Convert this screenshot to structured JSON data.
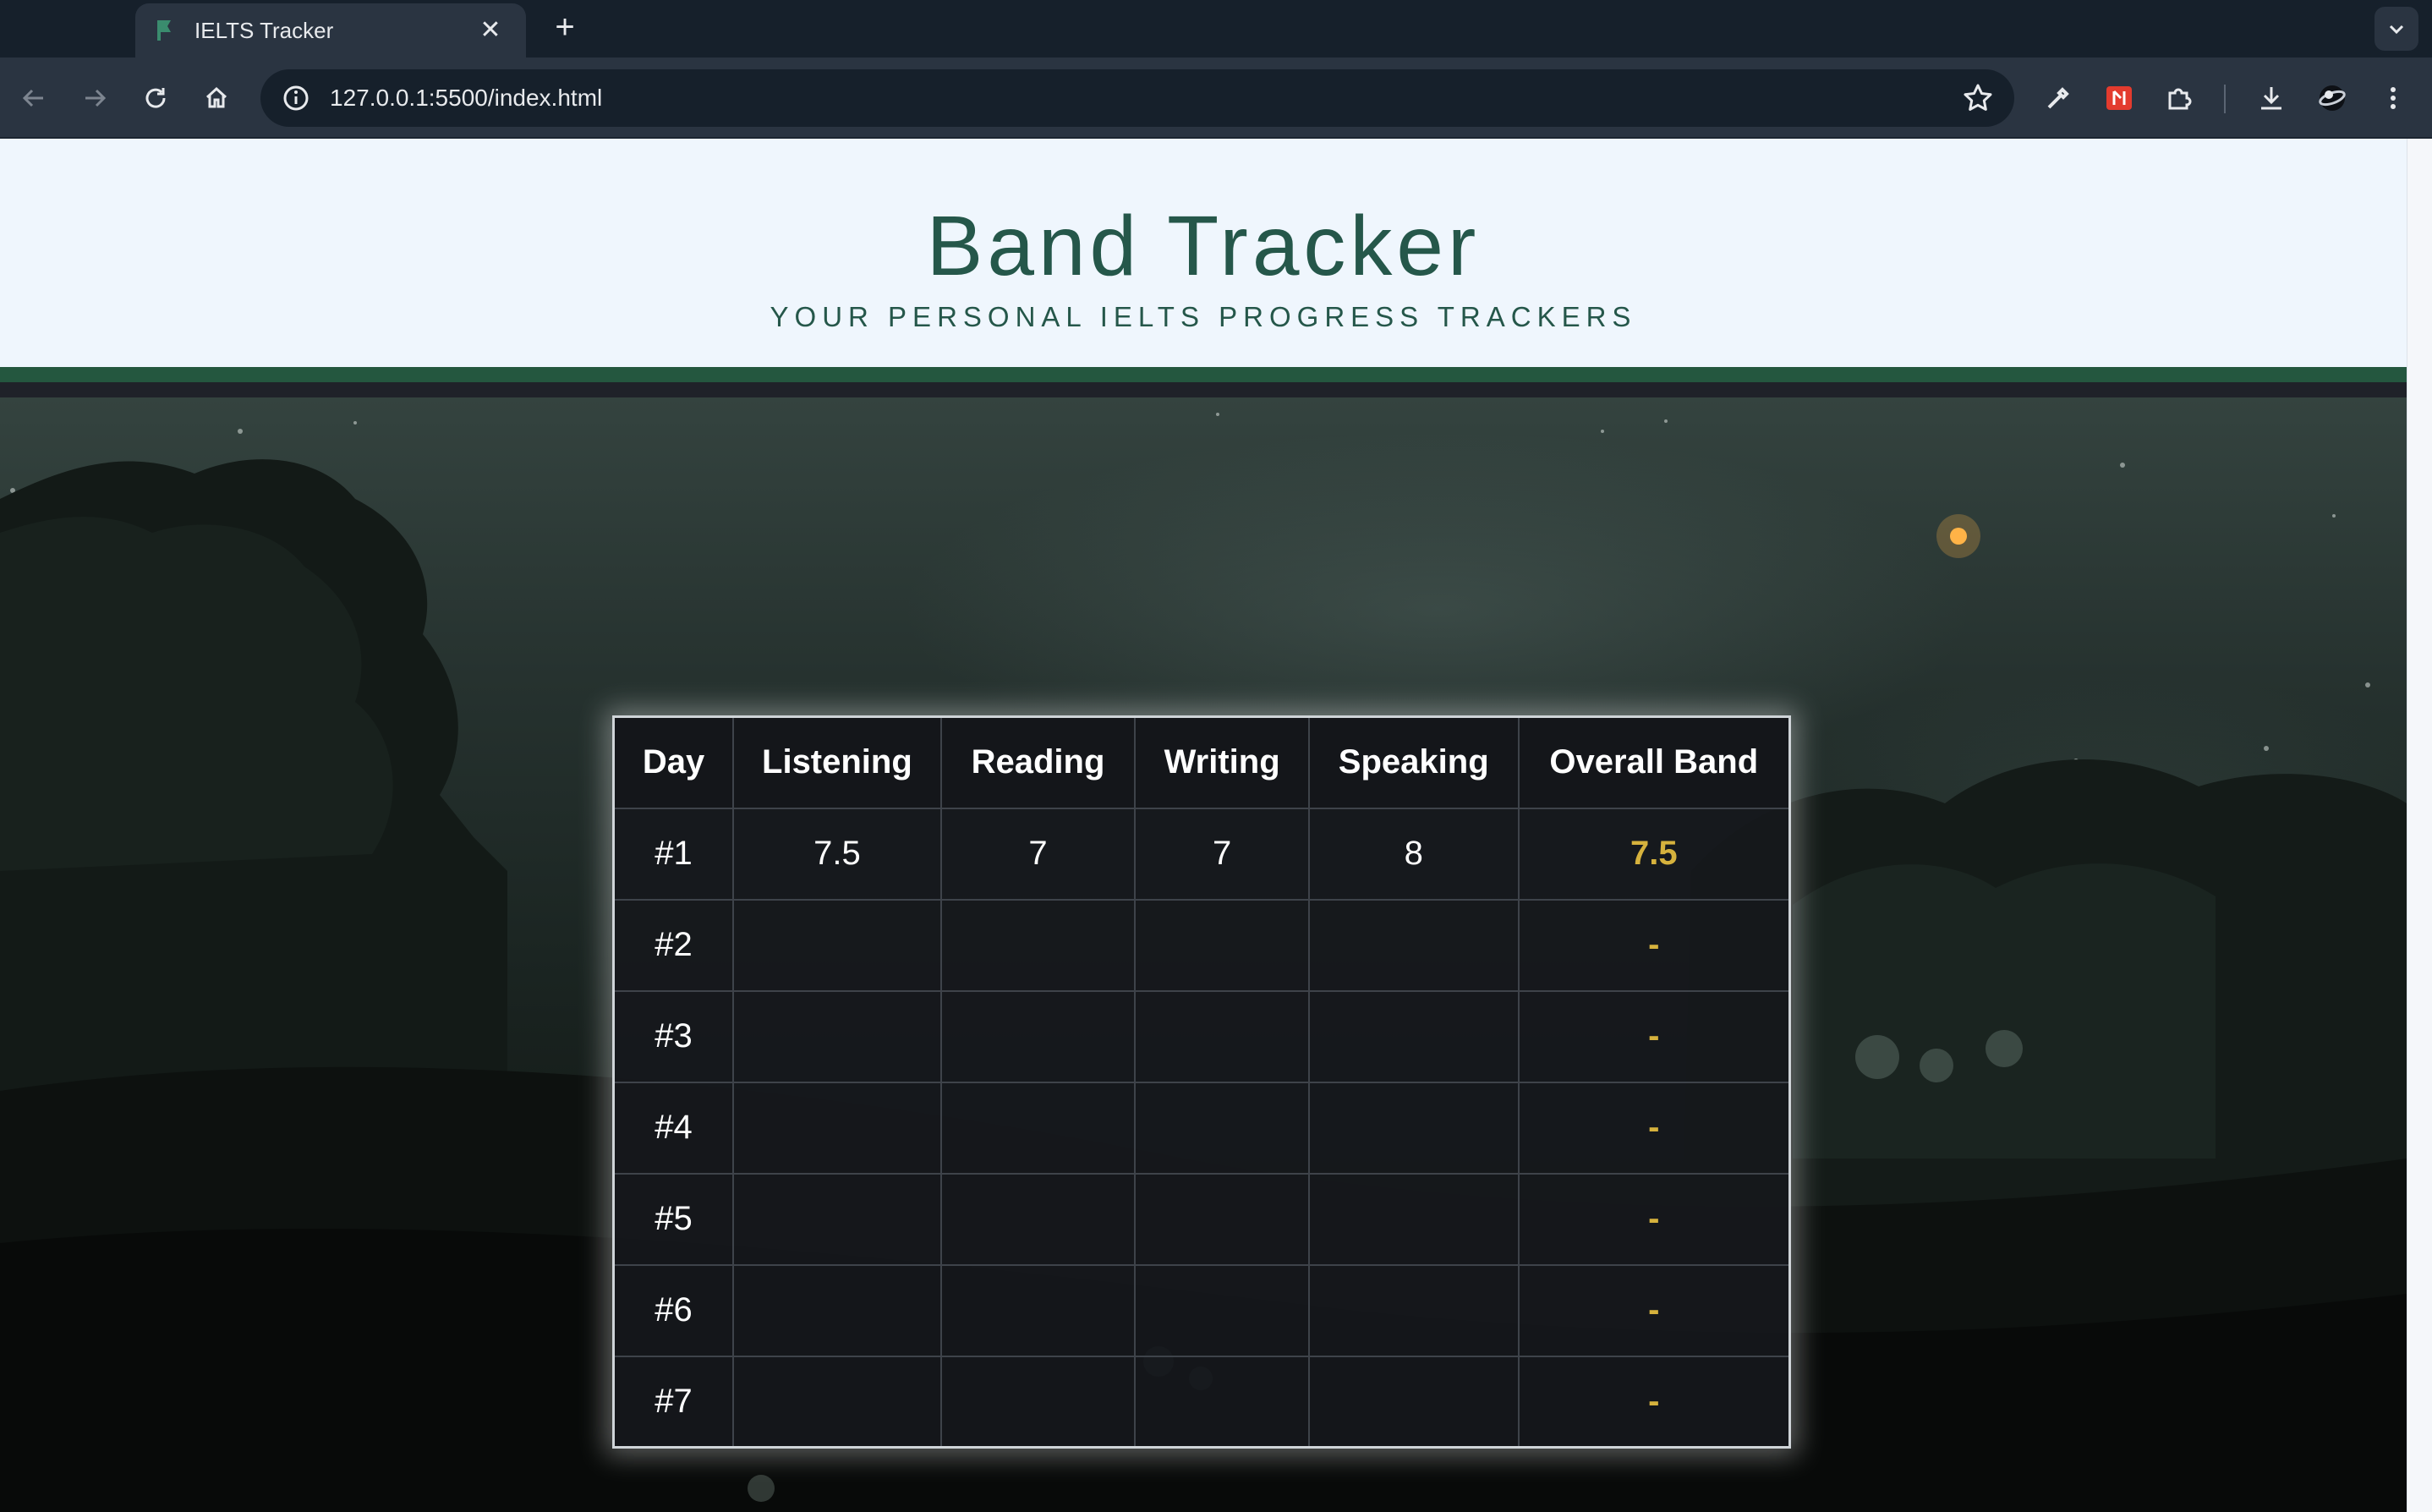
{
  "browser": {
    "tab_title": "IELTS Tracker",
    "tab_close": "✕",
    "new_tab": "+",
    "url": "127.0.0.1:5500/index.html"
  },
  "site": {
    "title": "Band Tracker",
    "subtitle": "YOUR PERSONAL IELTS PROGRESS TRACKERS"
  },
  "table": {
    "headers": {
      "day": "Day",
      "listening": "Listening",
      "reading": "Reading",
      "writing": "Writing",
      "speaking": "Speaking",
      "overall": "Overall Band"
    },
    "rows": [
      {
        "day": "#1",
        "listening": "7.5",
        "reading": "7",
        "writing": "7",
        "speaking": "8",
        "overall": "7.5"
      },
      {
        "day": "#2",
        "listening": "",
        "reading": "",
        "writing": "",
        "speaking": "",
        "overall": "-"
      },
      {
        "day": "#3",
        "listening": "",
        "reading": "",
        "writing": "",
        "speaking": "",
        "overall": "-"
      },
      {
        "day": "#4",
        "listening": "",
        "reading": "",
        "writing": "",
        "speaking": "",
        "overall": "-"
      },
      {
        "day": "#5",
        "listening": "",
        "reading": "",
        "writing": "",
        "speaking": "",
        "overall": "-"
      },
      {
        "day": "#6",
        "listening": "",
        "reading": "",
        "writing": "",
        "speaking": "",
        "overall": "-"
      },
      {
        "day": "#7",
        "listening": "",
        "reading": "",
        "writing": "",
        "speaking": "",
        "overall": "-"
      }
    ]
  },
  "colors": {
    "brand_green": "#25574a",
    "header_bar": "#24573f",
    "overall_accent": "#d6b23d"
  },
  "icons": [
    "back-icon",
    "forward-icon",
    "reload-icon",
    "home-icon",
    "site-info-icon",
    "bookmark-star-icon",
    "eyedropper-icon",
    "pdf-extension-icon",
    "extensions-puzzle-icon",
    "download-icon",
    "profile-avatar-icon",
    "kebab-menu-icon",
    "tab-search-chevron-icon"
  ]
}
